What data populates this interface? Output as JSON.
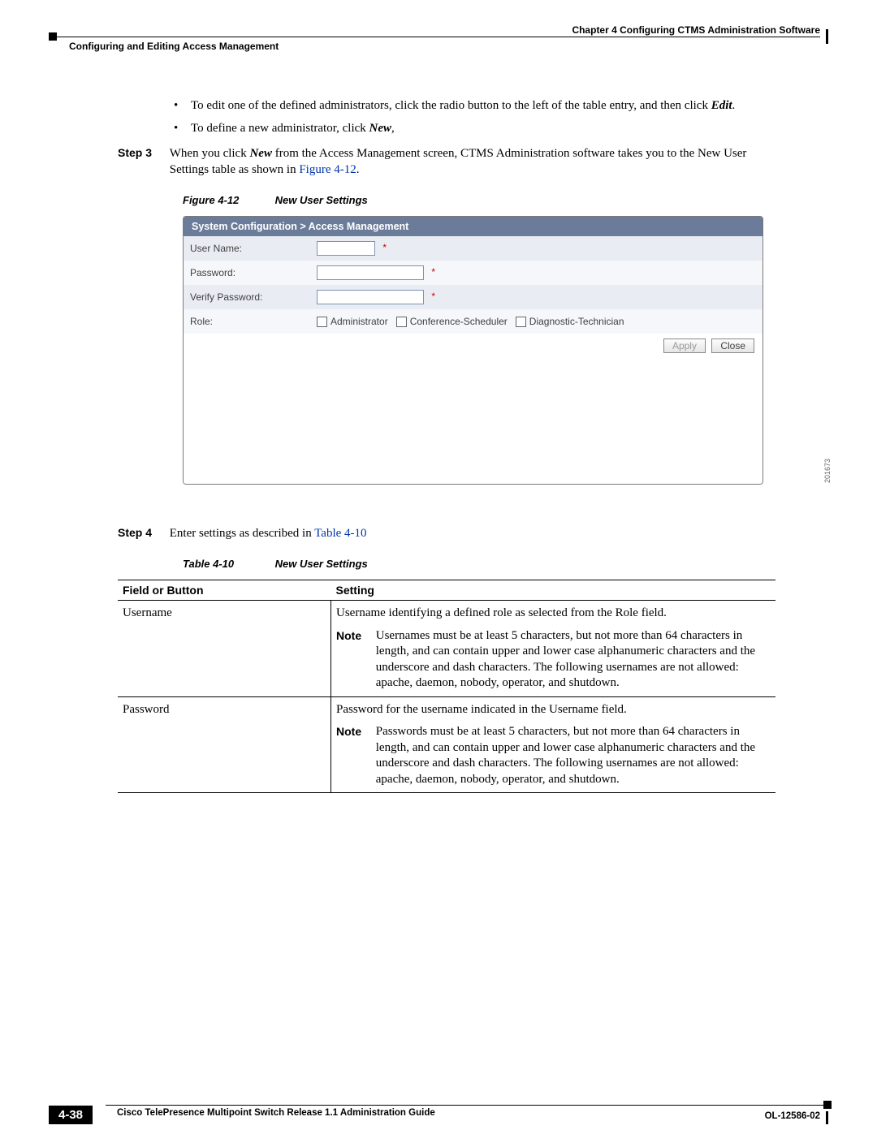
{
  "header": {
    "chapter": "Chapter 4      Configuring CTMS Administration Software",
    "section": "Configuring and Editing Access Management"
  },
  "bullets": [
    {
      "pre": "To edit one of the defined administrators, click the radio button to the left of the table entry, and then click ",
      "bold": "Edit",
      "post": "."
    },
    {
      "pre": "To define a new administrator, click ",
      "bold": "New",
      "post": ","
    }
  ],
  "step3": {
    "label": "Step 3",
    "text_pre": "When you click ",
    "text_bold": "New",
    "text_mid": " from the Access Management screen, CTMS Administration software takes you to the New User Settings table as shown in ",
    "xref": "Figure 4-12",
    "text_post": "."
  },
  "fig": {
    "no": "Figure 4-12",
    "title": "New User Settings"
  },
  "shot": {
    "title": "System Configuration > Access Management",
    "rows": {
      "username": "User Name:",
      "password": "Password:",
      "verify": "Verify Password:",
      "role": "Role:"
    },
    "roles": [
      "Administrator",
      "Conference-Scheduler",
      "Diagnostic-Technician"
    ],
    "apply": "Apply",
    "close": "Close",
    "sideno": "201673"
  },
  "step4": {
    "label": "Step 4",
    "text_pre": "Enter settings as described in ",
    "xref": "Table 4-10"
  },
  "tabcap": {
    "no": "Table 4-10",
    "title": "New User Settings"
  },
  "table": {
    "h1": "Field or Button",
    "h2": "Setting",
    "r1": {
      "field": "Username",
      "setting": "Username identifying a defined role as selected from the Role field.",
      "note_label": "Note",
      "note": "Usernames must be at least 5 characters, but not more than 64 characters in length, and can contain upper and lower case alphanumeric characters and the underscore and dash characters. The following usernames are not allowed: apache, daemon, nobody, operator, and shutdown."
    },
    "r2": {
      "field": "Password",
      "setting": "Password for the username indicated in the Username field.",
      "note_label": "Note",
      "note": "Passwords must be at least 5 characters, but not more than 64 characters in length, and can contain upper and lower case alphanumeric characters and the underscore and dash characters. The following usernames are not allowed: apache, daemon, nobody, operator, and shutdown."
    }
  },
  "footer": {
    "guide": "Cisco TelePresence Multipoint Switch Release 1.1 Administration Guide",
    "page": "4-38",
    "docid": "OL-12586-02"
  }
}
